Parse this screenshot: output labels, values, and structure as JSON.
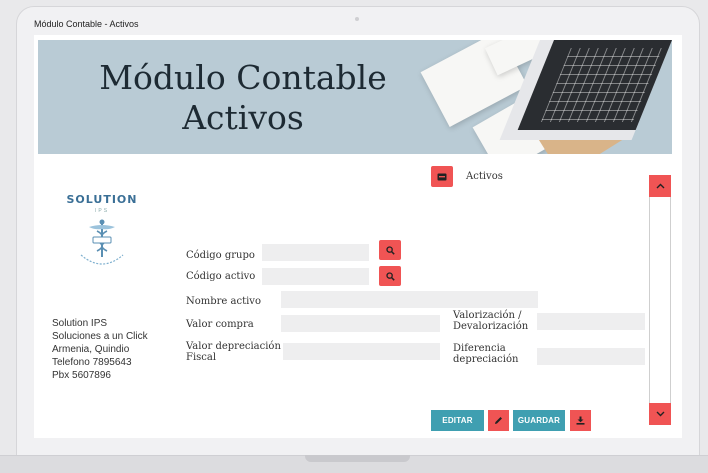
{
  "window": {
    "title": "Módulo Contable - Activos"
  },
  "banner": {
    "title_line1": "Módulo Contable",
    "title_line2": "Activos"
  },
  "logo": {
    "name": "SOLUTION",
    "sub": "IPS"
  },
  "company": {
    "line1": "Solution IPS",
    "line2": "Soluciones a un Click",
    "line3": "Armenia, Quindio",
    "line4": "Telefono 7895643",
    "line5": "Pbx 5607896"
  },
  "section": {
    "label": "Activos",
    "icon": "card-icon"
  },
  "form": {
    "codigo_grupo": {
      "label": "Código grupo",
      "value": ""
    },
    "codigo_activo": {
      "label": "Código activo",
      "value": ""
    },
    "nombre_activo": {
      "label": "Nombre activo",
      "value": ""
    },
    "valor_compra": {
      "label": "Valor compra",
      "value": ""
    },
    "valorizacion": {
      "label_line1": "Valorización /",
      "label_line2": "Devalorización",
      "value": ""
    },
    "valor_depreciacion": {
      "label_line1": "Valor depreciación",
      "label_line2": "Fiscal",
      "value": ""
    },
    "diferencia_depreciacion": {
      "label_line1": "Diferencia",
      "label_line2": "depreciación",
      "value": ""
    }
  },
  "actions": {
    "edit_label": "EDITAR",
    "save_label": "GUARDAR"
  },
  "colors": {
    "accent_red": "#f05454",
    "accent_teal": "#3f9fb1",
    "banner_bg": "#b9cbd5"
  }
}
